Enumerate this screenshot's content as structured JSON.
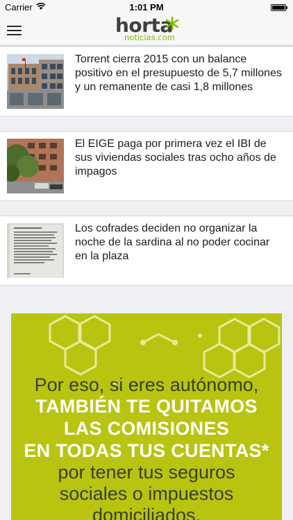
{
  "status_bar": {
    "carrier": "Carrier",
    "time": "1:01 PM"
  },
  "header": {
    "logo_word": "horta",
    "logo_sub": "noticias.com",
    "brand_color": "#7ab800"
  },
  "articles": [
    {
      "title": "Torrent cierra 2015 con un balance positivo en el presupuesto de 5,7 millones y un remanente de casi 1,8 millones",
      "image": "building-photo"
    },
    {
      "title": "El EIGE paga por primera vez el IBI de sus viviendas sociales tras ocho años de impagos",
      "image": "apartments-photo"
    },
    {
      "title": "Los cofrades deciden no organizar la noche de la sardina al no poder cocinar en la plaza",
      "image": "notice-photo"
    }
  ],
  "ad": {
    "background": "#b8c410",
    "lines": [
      {
        "text": "Por eso, si eres autónomo,",
        "style": "dark"
      },
      {
        "text": "TAMBIÉN TE QUITAMOS",
        "style": "light"
      },
      {
        "text": "LAS COMISIONES",
        "style": "light"
      },
      {
        "text": "EN TODAS TUS CUENTAS*",
        "style": "light"
      },
      {
        "text": "por tener tus seguros",
        "style": "dark"
      },
      {
        "text": "sociales o impuestos",
        "style": "dark"
      },
      {
        "text": "domiciliados.",
        "style": "dark"
      }
    ]
  }
}
